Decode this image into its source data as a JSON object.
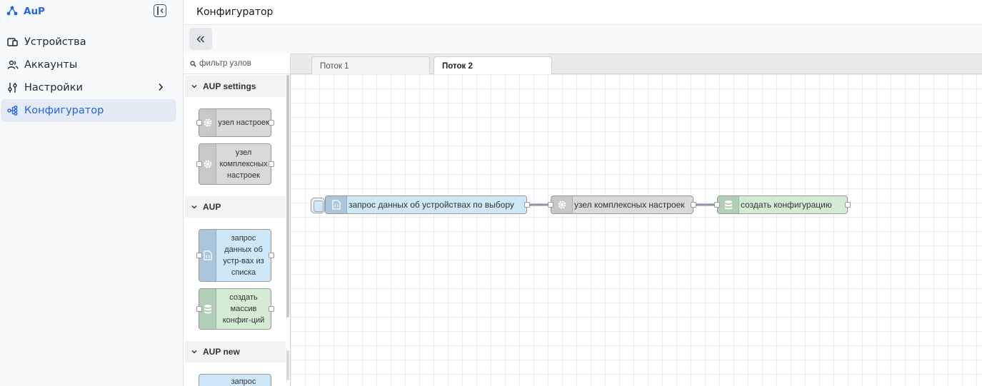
{
  "brand": {
    "name": "AuP"
  },
  "sidebar": {
    "items": [
      {
        "label": "Устройства",
        "icon": "devices-icon"
      },
      {
        "label": "Аккаунты",
        "icon": "users-icon"
      },
      {
        "label": "Настройки",
        "icon": "sliders-icon",
        "has_submenu": true
      },
      {
        "label": "Конфигуратор",
        "icon": "flow-icon",
        "active": true
      }
    ]
  },
  "header": {
    "title": "Конфигуратор"
  },
  "palette": {
    "filter_placeholder": "фильтр узлов",
    "categories": [
      {
        "name": "AUP settings",
        "nodes": [
          {
            "label": "узел настроек",
            "icon": "gear-icon"
          },
          {
            "label": "узел комплексных настроек",
            "icon": "gear-icon"
          }
        ]
      },
      {
        "name": "AUP",
        "nodes": [
          {
            "label": "запрос данных об устр-вах из списка",
            "icon": "file-code-icon"
          },
          {
            "label": "создать массив конфиг-ций",
            "icon": "database-icon"
          }
        ]
      },
      {
        "name": "AUP new",
        "nodes": [
          {
            "label": "запрос",
            "icon": "file-code-icon"
          }
        ]
      }
    ]
  },
  "workspace": {
    "tabs": [
      {
        "label": "Поток 1",
        "active": false
      },
      {
        "label": "Поток 2",
        "active": true
      }
    ],
    "flow_nodes": [
      {
        "label": "запрос данных об устройствах по выбору",
        "icon": "file-code-icon"
      },
      {
        "label": "узел комплексных настроек",
        "icon": "gear-icon"
      },
      {
        "label": "создать конфигурацию",
        "icon": "database-icon"
      }
    ]
  },
  "colors": {
    "accent": "#2563eb",
    "node_settings": "#d9d9d9",
    "node_request": "#cfe8f8",
    "node_create": "#d5ecd4",
    "wire": "#8a93a6"
  }
}
